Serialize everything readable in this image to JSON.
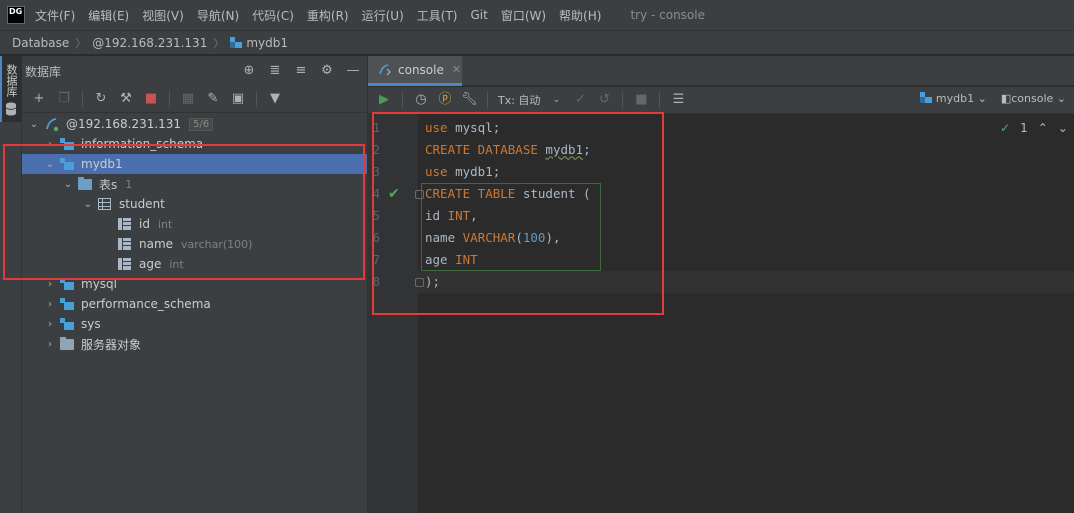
{
  "app": {
    "logo": "DG",
    "window_title": "try - console"
  },
  "menu": [
    "文件(F)",
    "编辑(E)",
    "视图(V)",
    "导航(N)",
    "代码(C)",
    "重构(R)",
    "运行(U)",
    "工具(T)",
    "Git",
    "窗口(W)",
    "帮助(H)"
  ],
  "breadcrumb": {
    "items": [
      "Database",
      "@192.168.231.131",
      "mydb1"
    ]
  },
  "left_strip": {
    "label": "数据库"
  },
  "db_panel": {
    "title": "数据库",
    "tree": {
      "connection": {
        "label": "@192.168.231.131",
        "badge": "5/6"
      },
      "information_schema": "information_schema",
      "mydb1": "mydb1",
      "tables_folder": {
        "label": "表s",
        "count": "1"
      },
      "student": "student",
      "columns": [
        {
          "name": "id",
          "type": "int"
        },
        {
          "name": "name",
          "type": "varchar(100)"
        },
        {
          "name": "age",
          "type": "int"
        }
      ],
      "mysql": "mysql",
      "performance_schema": "performance_schema",
      "sys": "sys",
      "server_objects": "服务器对象"
    }
  },
  "editor": {
    "tab_label": "console",
    "tx_mode": "Tx: 自动",
    "context_schema": "mydb1",
    "context_session": "console",
    "inspection_count": "1",
    "line_numbers": [
      "1",
      "2",
      "3",
      "4",
      "5",
      "6",
      "7",
      "8"
    ]
  },
  "colors": {
    "selection": "#4b6eaf",
    "annotation": "#e33b3b",
    "keyword": "#cc7832",
    "number": "#6897bb"
  }
}
